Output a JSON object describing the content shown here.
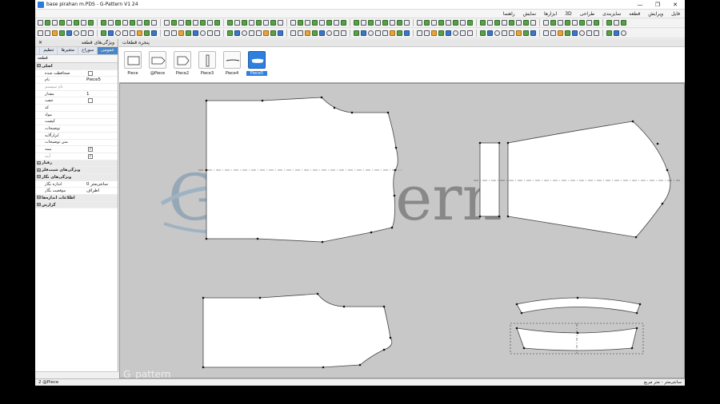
{
  "window": {
    "title": "base pirahan m.PDS - G-Pattern V1 24",
    "minimize": "—",
    "maximize": "❐",
    "close": "✕"
  },
  "menu": [
    "فایل",
    "ویرایش",
    "قطعه",
    "سایزبندی",
    "طراحی",
    "3D",
    "ابزارها",
    "نمایش",
    "راهنما"
  ],
  "left_panel": {
    "title": "ویژگی‌های قطعه",
    "close": "✕",
    "tabs": [
      "عمومی",
      "سوراخ",
      "متغیرها",
      "تنظیم"
    ],
    "search": "قطعه",
    "rows": [
      {
        "type": "group",
        "label": "اصلی"
      },
      {
        "type": "check",
        "label": "صحافظت شده",
        "checked": ""
      },
      {
        "type": "text",
        "label": "نام",
        "value": "Piece5"
      },
      {
        "type": "dim",
        "label": "نام سیستم",
        "value": ""
      },
      {
        "type": "text",
        "label": "مقدار",
        "value": "1"
      },
      {
        "type": "check",
        "label": "جفت",
        "checked": ""
      },
      {
        "type": "text",
        "label": "کد",
        "value": ""
      },
      {
        "type": "text",
        "label": "مواد",
        "value": ""
      },
      {
        "type": "text",
        "label": "کیفیت",
        "value": ""
      },
      {
        "type": "text",
        "label": "توضیحات",
        "value": ""
      },
      {
        "type": "text",
        "label": "ابزارآلایه",
        "value": ""
      },
      {
        "type": "text",
        "label": "متن توضیحات",
        "value": ""
      },
      {
        "type": "check",
        "label": "نیمه",
        "checked": "✓"
      },
      {
        "type": "dimcheck",
        "label": "آینه",
        "checked": "✓"
      },
      {
        "type": "group",
        "label": "رفتار"
      },
      {
        "type": "group",
        "label": "ویژگی‌های شیت‌فلز"
      },
      {
        "type": "group",
        "label": "ویژگی‌های نگار"
      },
      {
        "type": "text",
        "label": "اندازه نگار",
        "value": "0 سانتی‌متر"
      },
      {
        "type": "text",
        "label": "موقعیت نگار",
        "value": "اطراف"
      },
      {
        "type": "group",
        "label": "اطلاعات اندازه‌ها"
      },
      {
        "type": "group",
        "label": "گزارش"
      }
    ]
  },
  "category_bar": {
    "title": "پنجره قطعات"
  },
  "thumbnails": [
    {
      "label": "Piece",
      "selected": false,
      "shape": "rect"
    },
    {
      "label": "@Piece",
      "selected": false,
      "shape": "tab"
    },
    {
      "label": "Piece2",
      "selected": false,
      "shape": "pent"
    },
    {
      "label": "Piece3",
      "selected": false,
      "shape": "bar"
    },
    {
      "label": "Piece4",
      "selected": false,
      "shape": "line"
    },
    {
      "label": "Piece5",
      "selected": true,
      "shape": "lens"
    }
  ],
  "watermark": {
    "letter": "G",
    "text": "pattern"
  },
  "channel_watermark": "G_pattern",
  "status": {
    "left": "2 @Piece",
    "right": "سانتی‌متر - متر مربع"
  },
  "colors": {
    "accent": "#2d7fe0",
    "canvas": "#c8c8c8",
    "watermark": "#4a6f8a"
  }
}
